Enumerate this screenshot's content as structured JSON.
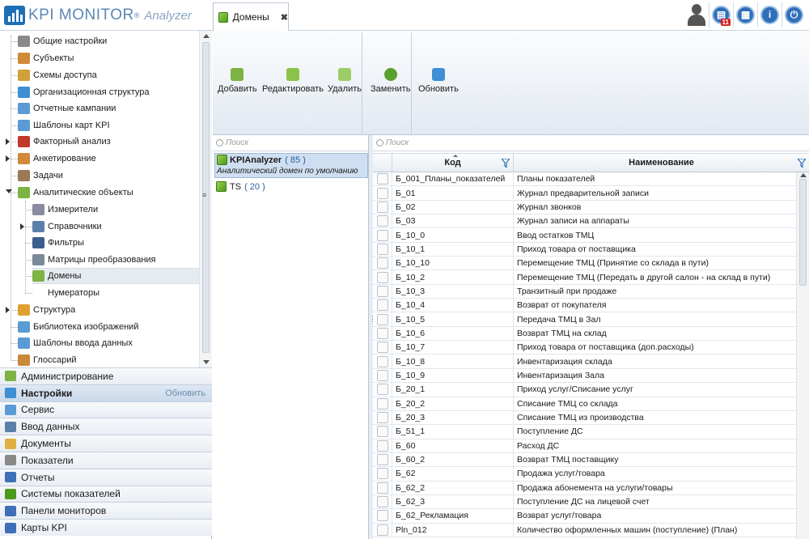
{
  "app": {
    "brand": "KPI MONITOR",
    "registered": "®",
    "edition": "Analyzer"
  },
  "tab": {
    "label": "Домены",
    "close": "✖"
  },
  "notifications_count": "11",
  "tree": [
    {
      "label": "Общие настройки",
      "icon": "gear-icon",
      "color": "#8a8a8a"
    },
    {
      "label": "Субъекты",
      "icon": "users-icon",
      "color": "#d08a3a"
    },
    {
      "label": "Схемы доступа",
      "icon": "access-schemes-icon",
      "color": "#d0a03a"
    },
    {
      "label": "Организационная структура",
      "icon": "org-structure-icon",
      "color": "#3e8fd4"
    },
    {
      "label": "Отчетные кампании",
      "icon": "report-campaign-icon",
      "color": "#5b9bd5"
    },
    {
      "label": "Шаблоны карт KPI",
      "icon": "kpi-card-template-icon",
      "color": "#5b9bd5"
    },
    {
      "label": "Факторный анализ",
      "icon": "factor-analysis-icon",
      "color": "#c0392b"
    },
    {
      "label": "Анкетирование",
      "icon": "survey-icon",
      "color": "#d08a3a"
    },
    {
      "label": "Задачи",
      "icon": "tasks-icon",
      "color": "#9b7a5a"
    },
    {
      "label": "Аналитические объекты",
      "icon": "analytic-objects-icon",
      "color": "#7cb342"
    },
    {
      "label": "Измерители",
      "icon": "measures-icon",
      "color": "#8a8aa0"
    },
    {
      "label": "Справочники",
      "icon": "reference-books-icon",
      "color": "#5b7fa8"
    },
    {
      "label": "Фильтры",
      "icon": "filters-icon",
      "color": "#3b5e8c"
    },
    {
      "label": "Матрицы преобразования",
      "icon": "transform-matrix-icon",
      "color": "#7a8a9a"
    },
    {
      "label": "Домены",
      "icon": "domains-icon",
      "color": "#7cb342"
    },
    {
      "label": "Нумераторы",
      "icon": "numerators-icon",
      "color": "#ffffff"
    },
    {
      "label": "Структура",
      "icon": "structure-icon",
      "color": "#e0a030"
    },
    {
      "label": "Библиотека изображений",
      "icon": "image-library-icon",
      "color": "#5b9bd5"
    },
    {
      "label": "Шаблоны ввода данных",
      "icon": "input-templates-icon",
      "color": "#5b9bd5"
    },
    {
      "label": "Глоссарий",
      "icon": "glossary-icon",
      "color": "#c98a3a"
    }
  ],
  "nav": [
    {
      "label": "Администрирование",
      "icon": "administration-icon",
      "color": "#7cb342",
      "extra": ""
    },
    {
      "label": "Настройки",
      "icon": "settings-icon",
      "color": "#3e8fd4",
      "extra": "Обновить"
    },
    {
      "label": "Сервис",
      "icon": "service-icon",
      "color": "#5b9bd5",
      "extra": ""
    },
    {
      "label": "Ввод данных",
      "icon": "data-input-icon",
      "color": "#5b7fa8",
      "extra": ""
    },
    {
      "label": "Документы",
      "icon": "documents-icon",
      "color": "#e0b040",
      "extra": ""
    },
    {
      "label": "Показатели",
      "icon": "indicators-icon",
      "color": "#8a8a8a",
      "extra": ""
    },
    {
      "label": "Отчеты",
      "icon": "reports-icon",
      "color": "#3e6fb8",
      "extra": ""
    },
    {
      "label": "Системы показателей",
      "icon": "indicator-systems-icon",
      "color": "#4e9a1e",
      "extra": ""
    },
    {
      "label": "Панели мониторов",
      "icon": "monitor-panels-icon",
      "color": "#3e6fb8",
      "extra": ""
    },
    {
      "label": "Карты KPI",
      "icon": "kpi-cards-icon",
      "color": "#3e6fb8",
      "extra": ""
    }
  ],
  "ribbon": {
    "add": "Добавить",
    "edit": "Редактировать",
    "delete": "Удалить",
    "replace": "Заменить",
    "refresh": "Обновить"
  },
  "search": {
    "placeholder": "Поиск"
  },
  "domains": [
    {
      "name": "KPIAnalyzer",
      "count": "( 85 )",
      "description": "Аналитический домен по умолчанию"
    },
    {
      "name": "TS",
      "count": "( 20 )",
      "description": ""
    }
  ],
  "grid": {
    "columns": [
      "Код",
      "Наименование"
    ],
    "rows": [
      [
        "Б_001_Планы_показателей",
        "Планы показателей"
      ],
      [
        "Б_01",
        "Журнал предварительной записи"
      ],
      [
        "Б_02",
        "Журнал звонков"
      ],
      [
        "Б_03",
        "Журнал записи на аппараты"
      ],
      [
        "Б_10_0",
        "Ввод остатков ТМЦ"
      ],
      [
        "Б_10_1",
        "Приход товара от поставщика"
      ],
      [
        "Б_10_10",
        "Перемещение ТМЦ (Принятие со склада в пути)"
      ],
      [
        "Б_10_2",
        "Перемещение ТМЦ (Передать в другой салон - на склад в пути)"
      ],
      [
        "Б_10_3",
        "Транзитный при продаже"
      ],
      [
        "Б_10_4",
        "Возврат от покупателя"
      ],
      [
        "Б_10_5",
        "Передача ТМЦ в Зал"
      ],
      [
        "Б_10_6",
        "Возврат ТМЦ на склад"
      ],
      [
        "Б_10_7",
        "Приход товара от поставщика (доп.расходы)"
      ],
      [
        "Б_10_8",
        "Инвентаризация склада"
      ],
      [
        "Б_10_9",
        "Инвентаризация Зала"
      ],
      [
        "Б_20_1",
        "Приход услуг/Списание услуг"
      ],
      [
        "Б_20_2",
        "Списание ТМЦ со склада"
      ],
      [
        "Б_20_3",
        "Списание ТМЦ из производства"
      ],
      [
        "Б_51_1",
        "Поступление ДС"
      ],
      [
        "Б_60",
        "Расход ДС"
      ],
      [
        "Б_60_2",
        "Возврат ТМЦ поставщику"
      ],
      [
        "Б_62",
        "Продажа услуг/товара"
      ],
      [
        "Б_62_2",
        "Продажа абонемента на услуги/товары"
      ],
      [
        "Б_62_3",
        "Поступление ДС на лицевой счет"
      ],
      [
        "Б_62_Рекламация",
        "Возврат услуг/товара"
      ],
      [
        "Pln_012",
        "Количество оформленных машин (поступление) (План)"
      ]
    ]
  }
}
